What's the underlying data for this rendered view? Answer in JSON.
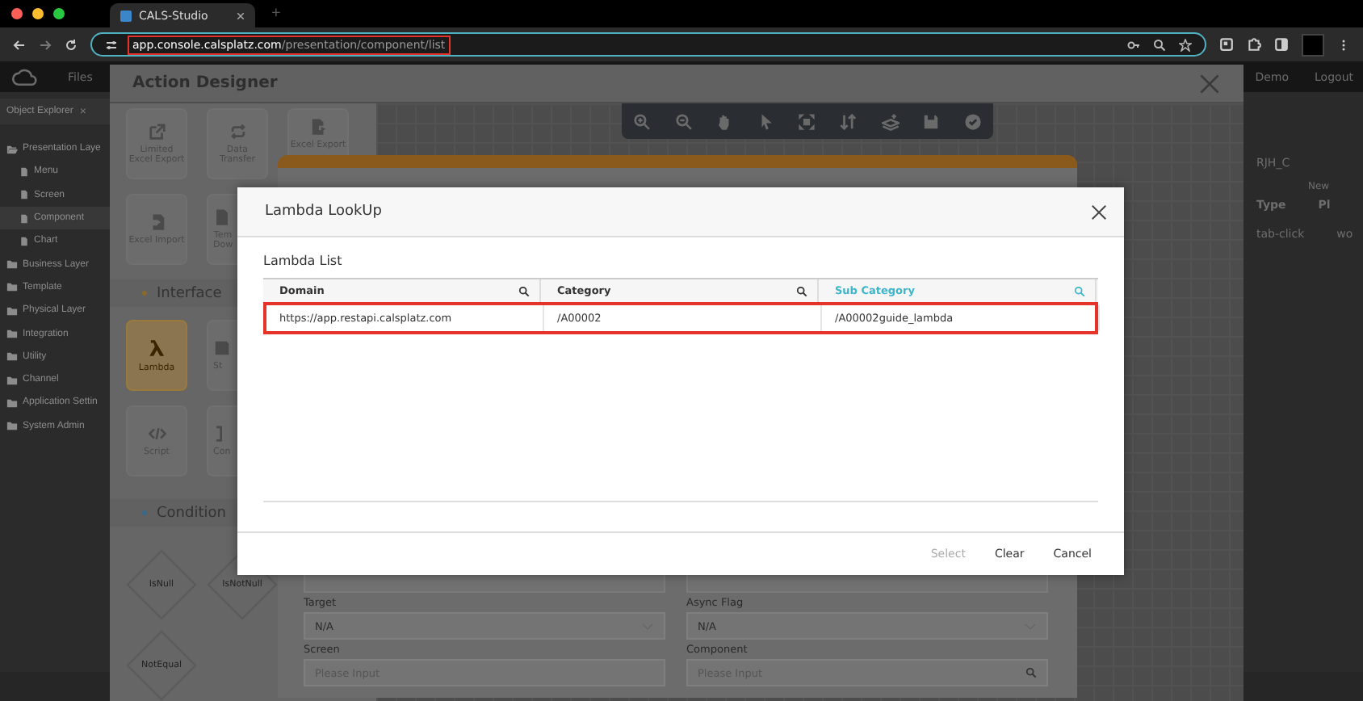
{
  "browser": {
    "tab_title": "CALS-Studio",
    "new_tab": "+",
    "url_host": "app.console.calsplatz.com",
    "url_path": "/presentation/component/list",
    "url_highlighted": true
  },
  "app_header": {
    "nav": "Files",
    "user": "Demo",
    "logout": "Logout"
  },
  "object_explorer": {
    "title": "Object Explorer",
    "close": "×",
    "items": [
      {
        "label": "Presentation Laye",
        "kind": "open-folder",
        "selected": false,
        "children": [
          {
            "label": "Menu",
            "kind": "file",
            "selected": false
          },
          {
            "label": "Screen",
            "kind": "file",
            "selected": false
          },
          {
            "label": "Component",
            "kind": "file",
            "selected": true
          },
          {
            "label": "Chart",
            "kind": "file",
            "selected": false
          }
        ]
      },
      {
        "label": "Business Layer",
        "kind": "folder",
        "selected": false
      },
      {
        "label": "Template",
        "kind": "folder",
        "selected": false
      },
      {
        "label": "Physical Layer",
        "kind": "folder",
        "selected": false
      },
      {
        "label": "Integration",
        "kind": "folder",
        "selected": false
      },
      {
        "label": "Utility",
        "kind": "folder",
        "selected": false
      },
      {
        "label": "Channel",
        "kind": "folder",
        "selected": false
      },
      {
        "label": "Application Settin",
        "kind": "folder",
        "selected": false
      },
      {
        "label": "System Admin",
        "kind": "folder",
        "selected": false
      }
    ]
  },
  "right_panel": {
    "name": "RJH_C",
    "new": "New",
    "columns": [
      "Type",
      "Pl"
    ],
    "row": [
      "tab-click",
      "wo"
    ]
  },
  "action_designer": {
    "title": "Action Designer",
    "tiles": [
      {
        "label": "Limited Excel Export"
      },
      {
        "label": "Data Transfer"
      },
      {
        "label": "Excel Export"
      },
      {
        "label": "Excel Import"
      },
      {
        "label": "Tem Dow"
      }
    ],
    "interface": {
      "title": "Interface",
      "tiles": [
        {
          "label": "Lambda",
          "selected": true
        },
        {
          "label": "St",
          "selected": false
        },
        {
          "label": "Script",
          "selected": false
        },
        {
          "label": "Con",
          "selected": false
        }
      ]
    },
    "condition": {
      "title": "Condition",
      "shapes": [
        "IsNull",
        "IsNotNull",
        "NotEqual"
      ]
    },
    "form": [
      {
        "label": "Target",
        "kind": "select",
        "value": "N/A"
      },
      {
        "label": "Async Flag",
        "kind": "select",
        "value": "N/A"
      },
      {
        "label": "Screen",
        "kind": "input",
        "placeholder": "Please Input"
      },
      {
        "label": "Component",
        "kind": "search",
        "placeholder": "Please Input"
      }
    ]
  },
  "lookup": {
    "title": "Lambda LookUp",
    "list_title": "Lambda List",
    "columns": [
      {
        "label": "Domain",
        "selected": false
      },
      {
        "label": "Category",
        "selected": false
      },
      {
        "label": "Sub Category",
        "selected": true
      }
    ],
    "rows": [
      {
        "cells": [
          "https://app.restapi.calsplatz.com",
          "/A00002",
          "/A00002guide_lambda"
        ],
        "highlighted": true
      }
    ],
    "buttons": [
      {
        "label": "Select",
        "disabled": true
      },
      {
        "label": "Clear",
        "disabled": false
      },
      {
        "label": "Cancel",
        "disabled": false
      }
    ]
  }
}
